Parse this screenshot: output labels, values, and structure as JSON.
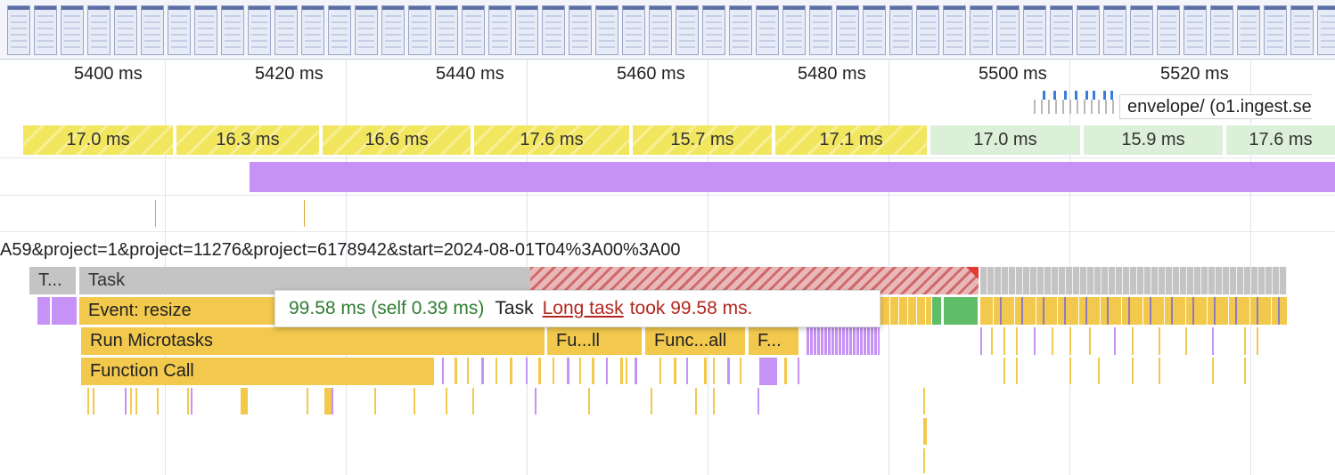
{
  "ruler": {
    "labels": [
      "5400 ms",
      "5420 ms",
      "5440 ms",
      "5460 ms",
      "5480 ms",
      "5500 ms",
      "5520 ms"
    ]
  },
  "network": {
    "label": "envelope/ (o1.ingest.se"
  },
  "frames": [
    "17.0 ms",
    "16.3 ms",
    "16.6 ms",
    "17.6 ms",
    "15.7 ms",
    "17.1 ms",
    "17.0 ms",
    "15.9 ms",
    "17.6 ms"
  ],
  "url_row": "A59&project=1&project=11276&project=6178942&start=2024-08-01T04%3A00%3A00",
  "flame": {
    "task_short": "T...",
    "task": "Task",
    "event": "Event: resize",
    "run_microtasks": "Run Microtasks",
    "function_call": "Function Call",
    "fu_short": "Fu...ll",
    "func_all": "Func...all",
    "f_short": "F..."
  },
  "tooltip": {
    "duration": "99.58 ms (self 0.39 ms)",
    "name": "Task",
    "warning_link": "Long task",
    "warning_text": "took 99.58 ms."
  },
  "colors": {
    "long_task": "#d06a6a",
    "tooltip_duration": "#2e7d32",
    "warning": "#b3261e"
  }
}
